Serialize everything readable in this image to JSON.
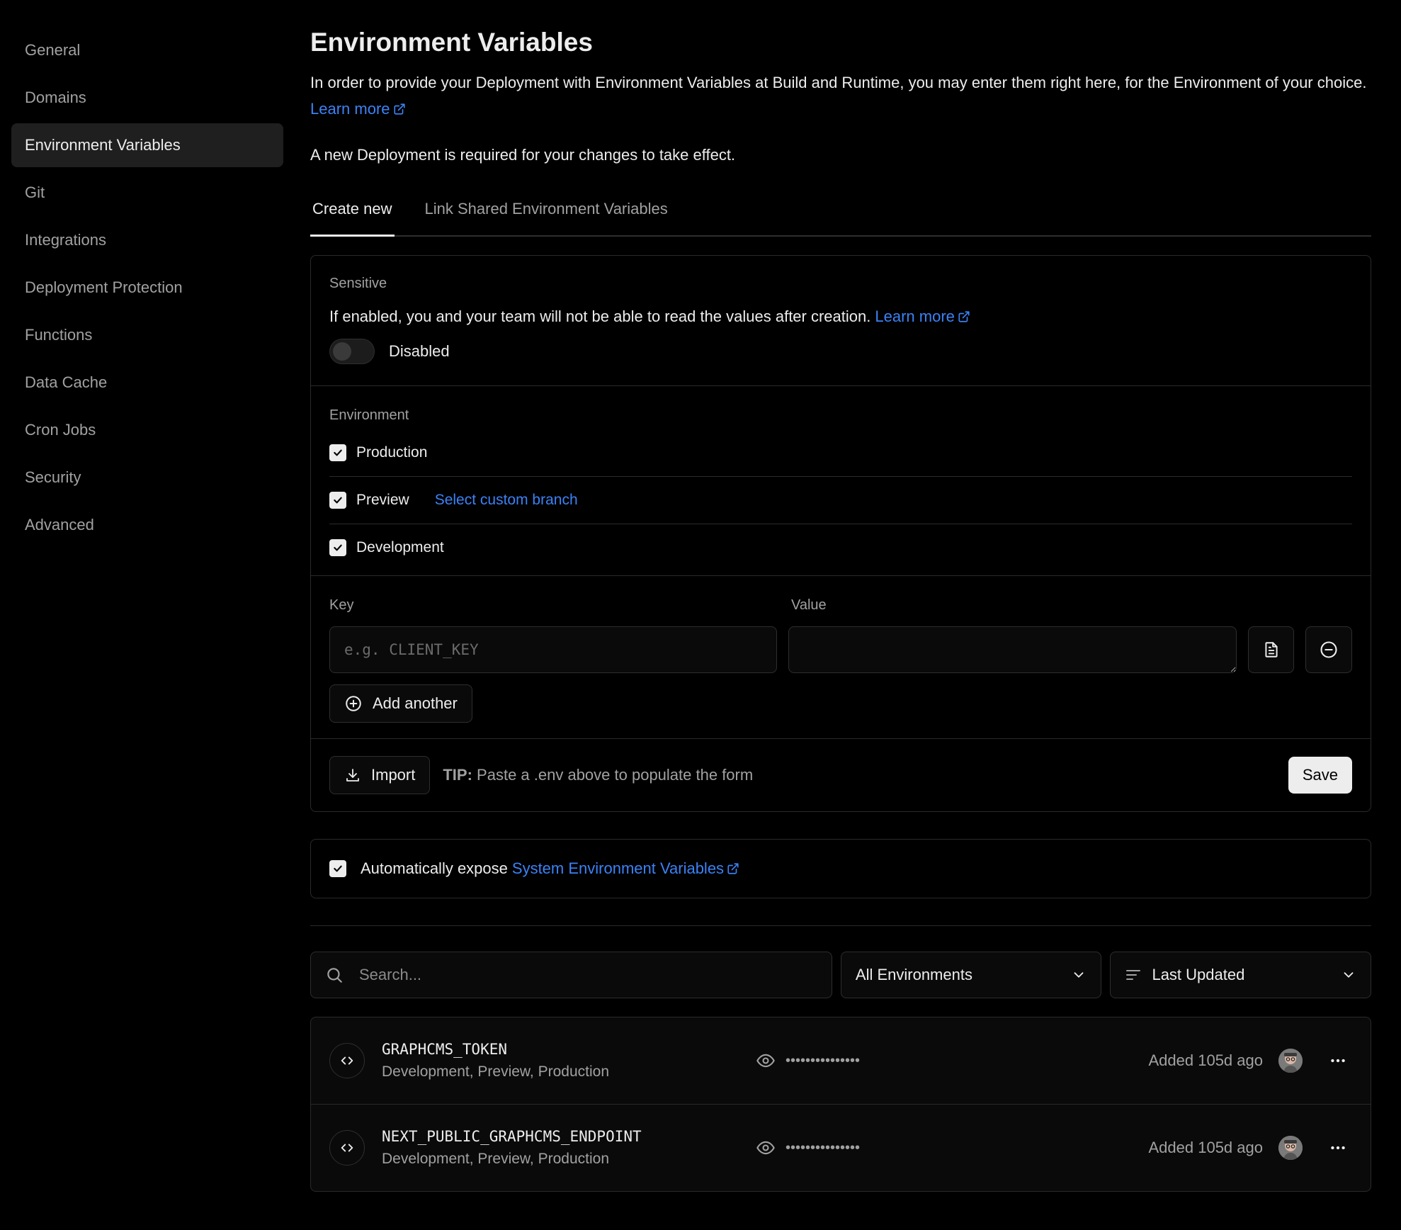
{
  "sidebar": {
    "items": [
      {
        "label": "General"
      },
      {
        "label": "Domains"
      },
      {
        "label": "Environment Variables",
        "active": true
      },
      {
        "label": "Git"
      },
      {
        "label": "Integrations"
      },
      {
        "label": "Deployment Protection"
      },
      {
        "label": "Functions"
      },
      {
        "label": "Data Cache"
      },
      {
        "label": "Cron Jobs"
      },
      {
        "label": "Security"
      },
      {
        "label": "Advanced"
      }
    ]
  },
  "header": {
    "title": "Environment Variables",
    "description": "In order to provide your Deployment with Environment Variables at Build and Runtime, you may enter them right here, for the Environment of your choice.",
    "learn_more": "Learn more",
    "note": "A new Deployment is required for your changes to take effect."
  },
  "tabs": [
    {
      "label": "Create new",
      "active": true
    },
    {
      "label": "Link Shared Environment Variables"
    }
  ],
  "sensitive": {
    "label": "Sensitive",
    "text": "If enabled, you and your team will not be able to read the values after creation.",
    "learn_more": "Learn more",
    "toggle_label": "Disabled"
  },
  "environment": {
    "label": "Environment",
    "options": [
      {
        "label": "Production",
        "checked": true
      },
      {
        "label": "Preview",
        "checked": true,
        "link": "Select custom branch"
      },
      {
        "label": "Development",
        "checked": true
      }
    ]
  },
  "kv": {
    "key_label": "Key",
    "value_label": "Value",
    "key_placeholder": "e.g. CLIENT_KEY",
    "value": "",
    "add_another": "Add another"
  },
  "footer": {
    "import_label": "Import",
    "tip_label": "TIP:",
    "tip_text": "Paste a .env above to populate the form",
    "save_label": "Save"
  },
  "expose": {
    "text": "Automatically expose",
    "link": "System Environment Variables"
  },
  "filters": {
    "search_placeholder": "Search...",
    "env_select": "All Environments",
    "sort_select": "Last Updated"
  },
  "variables": [
    {
      "key": "GRAPHCMS_TOKEN",
      "envs": "Development, Preview, Production",
      "masked": "•••••••••••••••",
      "added": "Added 105d ago"
    },
    {
      "key": "NEXT_PUBLIC_GRAPHCMS_ENDPOINT",
      "envs": "Development, Preview, Production",
      "masked": "•••••••••••••••",
      "added": "Added 105d ago"
    }
  ],
  "colors": {
    "background": "#000000",
    "link": "#3b82f6",
    "text": "#ededed",
    "muted": "#a1a1a1"
  }
}
